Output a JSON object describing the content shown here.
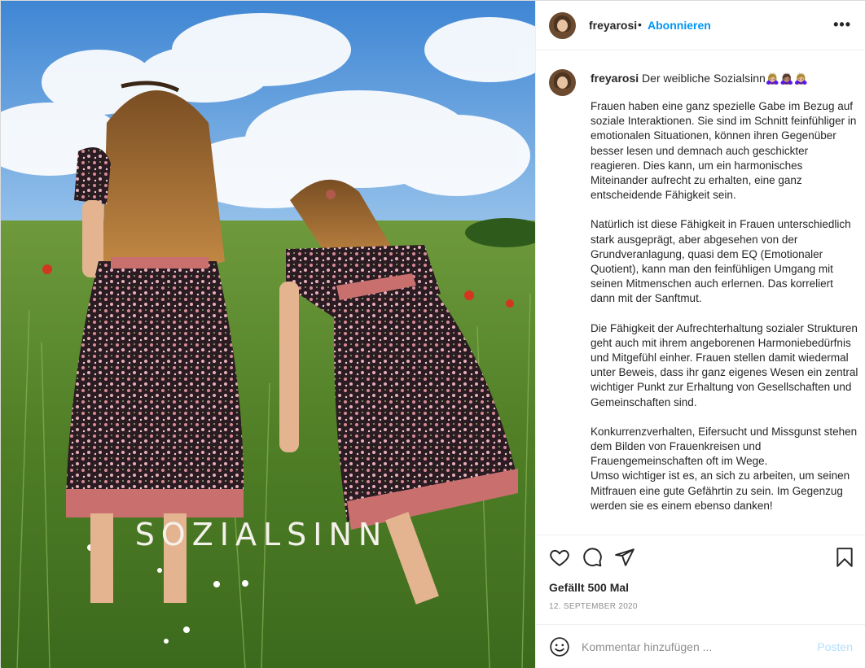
{
  "post": {
    "username": "freyarosi",
    "separator": "•",
    "follow_label": "Abonnieren",
    "more_label": "•••",
    "image_text": "SOZIALSINN",
    "caption_title": "Der weibliche Sozialsinn",
    "caption_emoji": "🙇🏼‍♀️🙇🏽‍♀️🙇🏼‍♀️",
    "caption_paragraphs": [
      "Frauen haben eine ganz spezielle Gabe im Bezug auf soziale Interaktionen. Sie sind im Schnitt feinfühliger in emotionalen Situationen, können ihren Gegenüber besser lesen und demnach auch geschickter reagieren. Dies kann, um ein harmonisches Miteinander aufrecht zu erhalten, eine ganz entscheidende Fähigkeit sein.",
      "Natürlich ist diese Fähigkeit in Frauen unterschiedlich stark ausgeprägt, aber abgesehen von der Grundveranlagung, quasi dem EQ (Emotionaler Quotient), kann man den feinfühligen Umgang mit seinen Mitmenschen auch erlernen. Das korreliert dann mit der Sanftmut.",
      "Die Fähigkeit der Aufrechterhaltung sozialer Strukturen geht auch mit ihrem angeborenen Harmoniebedürfnis und Mitgefühl einher. Frauen stellen damit wiedermal unter Beweis, dass ihr ganz eigenes Wesen ein zentral wichtiger Punkt zur Erhaltung von Gesellschaften und Gemeinschaften sind.",
      "Konkurrenzverhalten, Eifersucht und Missgunst stehen dem Bilden von Frauenkreisen und Frauengemeinschaften oft im Wege.\nUmso wichtiger ist es, an sich zu arbeiten, um seinen Mitfrauen eine gute Gefährtin zu sein. Im Gegenzug werden sie es einem ebenso danken!"
    ],
    "likes_text": "Gefällt 500 Mal",
    "date_text": "12. SEPTEMBER 2020",
    "comment_placeholder": "Kommentar hinzufügen ...",
    "post_button_label": "Posten"
  },
  "icons": [
    "heart-icon",
    "comment-icon",
    "share-icon",
    "bookmark-icon",
    "emoji-icon",
    "more-icon"
  ],
  "colors": {
    "accent": "#0095f6",
    "post_disabled": "#b2dffc",
    "text": "#262626",
    "muted": "#8e8e8e"
  }
}
